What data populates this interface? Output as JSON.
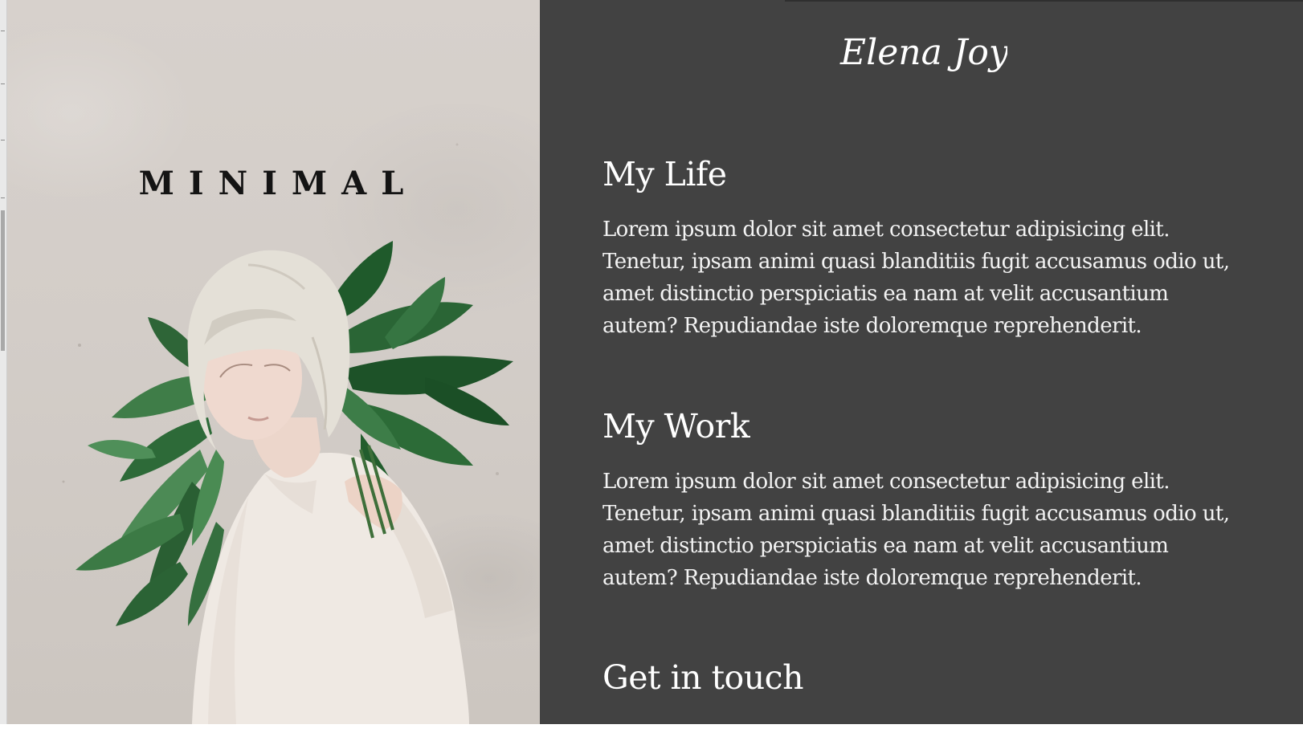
{
  "hero": {
    "title": "MINIMAL"
  },
  "brand": {
    "name": "Elena Joy"
  },
  "sections": [
    {
      "title": "My Life",
      "body": "Lorem ipsum dolor sit amet consectetur adipisicing elit. Tenetur, ipsam animi quasi blanditiis fugit accusamus odio ut, amet distinctio perspiciatis ea nam at velit accusantium autem? Repudiandae iste doloremque reprehenderit."
    },
    {
      "title": "My Work",
      "body": "Lorem ipsum dolor sit amet consectetur adipisicing elit. Tenetur, ipsam animi quasi blanditiis fugit accusamus odio ut, amet distinctio perspiciatis ea nam at velit accusantium autem? Repudiandae iste doloremque reprehenderit."
    },
    {
      "title": "Get in touch"
    }
  ],
  "colors": {
    "panel_dark": "#424242",
    "text_light": "#ffffff",
    "hero_bg": "#d3cdc8",
    "leaf_green": "#2f6b3a"
  }
}
